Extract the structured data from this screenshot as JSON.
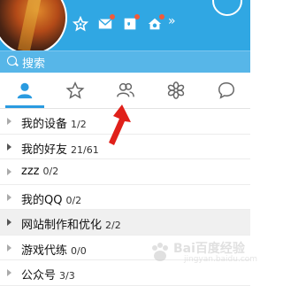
{
  "header": {
    "icons": [
      "avatar",
      "star-icon",
      "mail-icon",
      "photo-icon",
      "home-icon"
    ],
    "more": "»"
  },
  "search": {
    "placeholder": "搜索"
  },
  "tabs": [
    {
      "name": "contacts",
      "icon": "person-icon",
      "active": true
    },
    {
      "name": "favorites",
      "icon": "star-icon",
      "active": false
    },
    {
      "name": "groups",
      "icon": "group-icon",
      "active": false
    },
    {
      "name": "apps",
      "icon": "flower-icon",
      "active": false
    },
    {
      "name": "messages",
      "icon": "chat-icon",
      "active": false
    }
  ],
  "groups": [
    {
      "name": "我的设备",
      "count": "1/2"
    },
    {
      "name": "我的好友",
      "count": "21/61"
    },
    {
      "name": "zzz",
      "count": "0/2"
    },
    {
      "name": "我的QQ",
      "count": "0/2"
    },
    {
      "name": "网站制作和优化",
      "count": "2/2"
    },
    {
      "name": "游戏代练",
      "count": "0/0"
    },
    {
      "name": "公众号",
      "count": "3/3"
    }
  ],
  "colors": {
    "header": "#30a7e3",
    "search": "#57b6e8",
    "accent": "#2a9be0",
    "annotation": "#e0201a"
  }
}
